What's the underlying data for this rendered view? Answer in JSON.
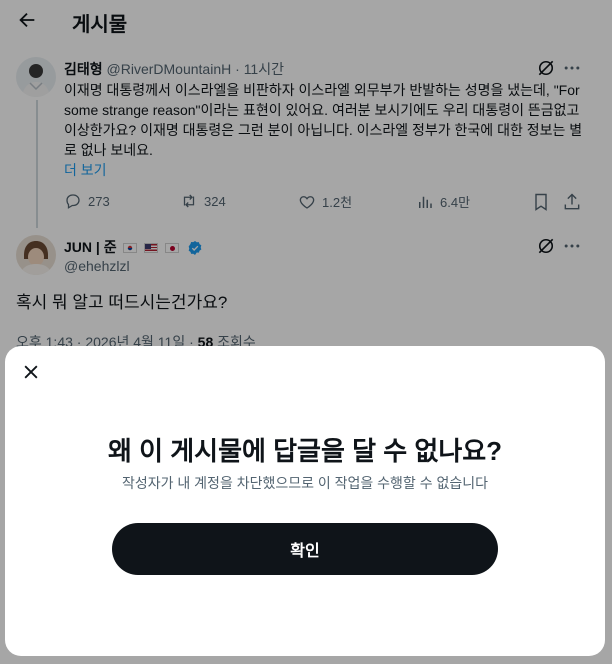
{
  "header": {
    "title": "게시물"
  },
  "post": {
    "author_name": "김태형",
    "author_handle": "@RiverDMountainH",
    "separator": "·",
    "time": "11시간",
    "body": "이재명 대통령께서 이스라엘을 비판하자 이스라엘 외무부가 반발하는 성명을 냈는데, \"For some strange reason\"이라는 표현이 있어요. 여러분 보시기에도 우리 대통령이 뜬금없고 이상한가요? 이재명 대통령은 그런 분이 아닙니다. 이스라엘 정부가 한국에 대한 정보는 별로 없나 보네요.",
    "more_label": "더 보기",
    "actions": {
      "replies": "273",
      "reposts": "324",
      "likes": "1.2천",
      "views": "6.4만"
    }
  },
  "reply": {
    "author_name": "JUN | 준",
    "author_handle": "@ehehzlzl",
    "text": "혹시 뭐 알고 떠드시는건가요?",
    "meta_time": "오후 1:43 · 2026년 4월 11일 · ",
    "meta_views_count": "58",
    "meta_views_label": " 조회수"
  },
  "dialog": {
    "title": "왜 이 게시물에 답글을 달 수 없나요?",
    "description": "작성자가 내 계정을 차단했으므로 이 작업을 수행할 수 없습니다",
    "confirm_label": "확인"
  },
  "colors": {
    "text": "#0f1419",
    "muted": "#536471",
    "link": "#1d9bf0",
    "verified": "#1d9bf0",
    "button": "#0f1419"
  },
  "icons": [
    "back-arrow-icon",
    "grok-icon",
    "more-icon",
    "reply-icon",
    "repost-icon",
    "like-icon",
    "views-icon",
    "bookmark-icon",
    "share-icon",
    "verified-icon",
    "close-icon"
  ]
}
